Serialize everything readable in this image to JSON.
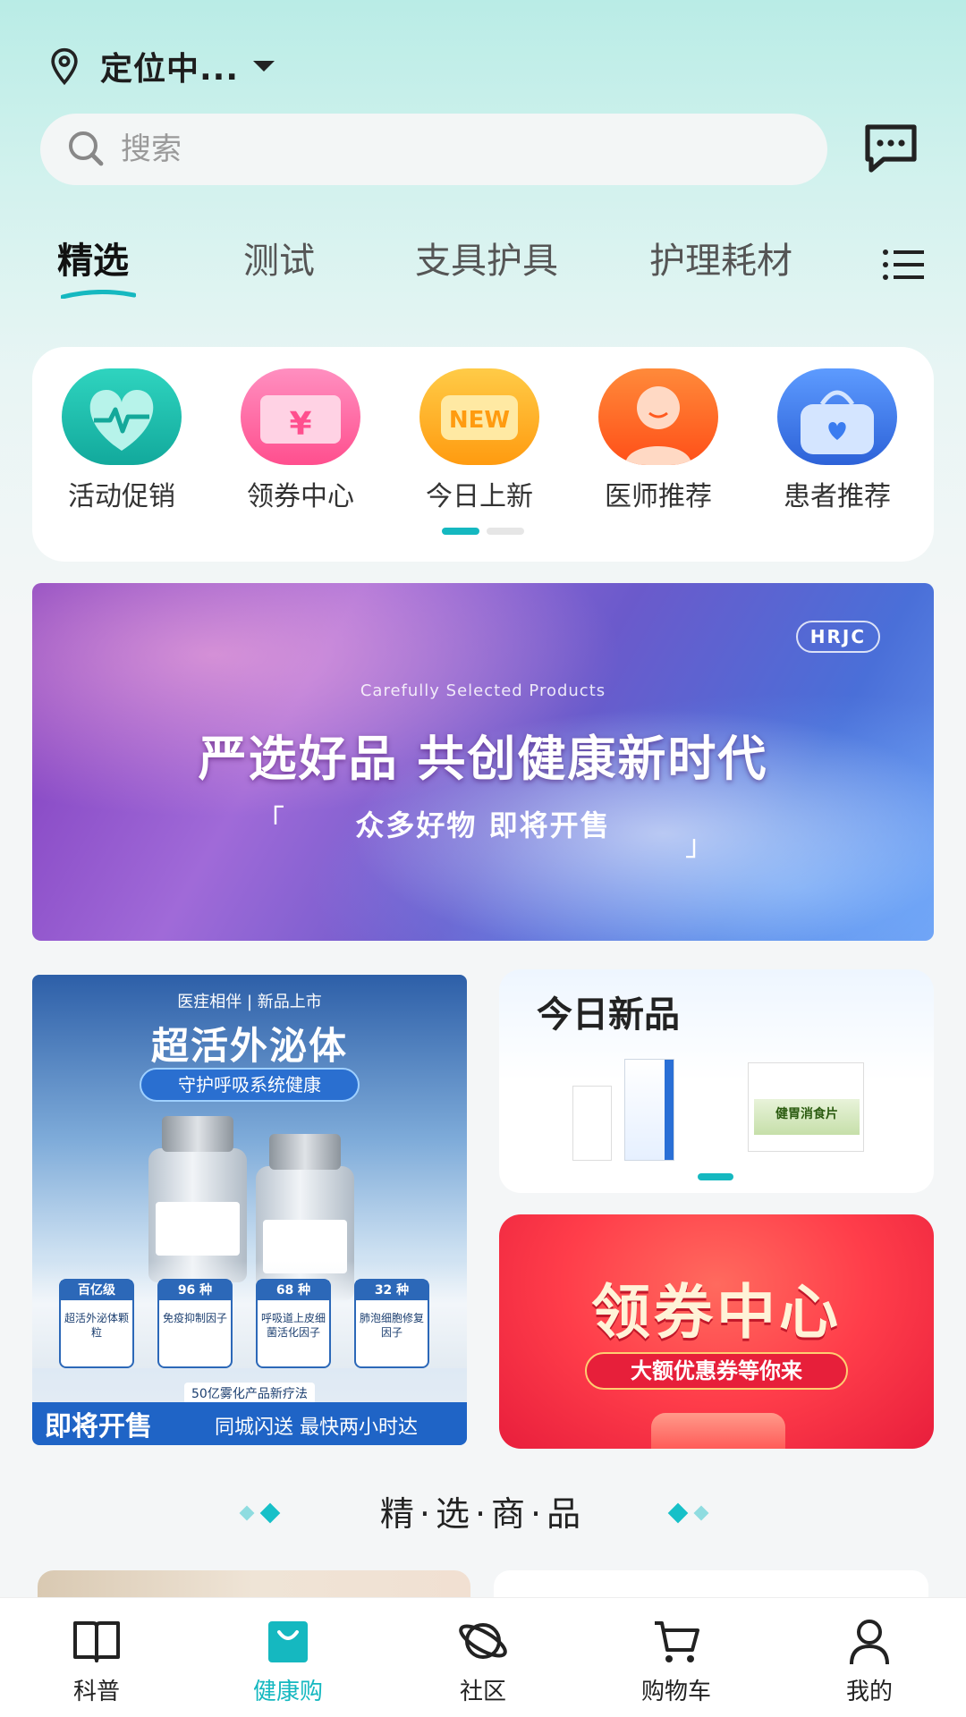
{
  "header": {
    "location_text": "定位中...",
    "search_placeholder": "搜索"
  },
  "tabs": [
    {
      "label": "精选",
      "active": true
    },
    {
      "label": "测试",
      "active": false
    },
    {
      "label": "支具护具",
      "active": false
    },
    {
      "label": "护理耗材",
      "active": false
    }
  ],
  "categories": [
    {
      "label": "活动促销",
      "icon": "heart-pulse-icon",
      "color": "#1fc4b0"
    },
    {
      "label": "领券中心",
      "icon": "coupon-icon",
      "color": "#ff6fa5"
    },
    {
      "label": "今日上新",
      "icon": "new-badge-icon",
      "color": "#ffb11f"
    },
    {
      "label": "医师推荐",
      "icon": "doctor-icon",
      "color": "#ff6a2a"
    },
    {
      "label": "患者推荐",
      "icon": "patient-bag-icon",
      "color": "#3a7cf0"
    }
  ],
  "banner": {
    "brand": "HRJC",
    "subtitle_en": "Carefully Selected Products",
    "title": "严选好品 共创健康新时代",
    "tagline": "众多好物 即将开售"
  },
  "promo_left": {
    "top_line": "医疰相伴 | 新品上市",
    "title": "超活外泌体",
    "pill": "守护呼吸系统健康",
    "cards": [
      {
        "head": "百亿级",
        "body": "超活外泌体颗粒"
      },
      {
        "head": "96 种",
        "body": "免疫抑制因子"
      },
      {
        "head": "68 种",
        "body": "呼吸道上皮细菌活化因子"
      },
      {
        "head": "32 种",
        "body": "肺泡细胞修复因子"
      }
    ],
    "note": "50亿雾化产品新疗法",
    "bar_left": "即将开售",
    "bar_right": "同城闪送 最快两小时达"
  },
  "promo_rt": {
    "title": "今日新品",
    "product_name": "健胃消食片"
  },
  "promo_rb": {
    "title": "领券中心",
    "pill": "大额优惠券等你来"
  },
  "section": {
    "title": "精·选·商·品"
  },
  "tabbar": [
    {
      "label": "科普",
      "icon": "book-icon",
      "active": false
    },
    {
      "label": "健康购",
      "icon": "shopping-bag-icon",
      "active": true
    },
    {
      "label": "社区",
      "icon": "planet-icon",
      "active": false
    },
    {
      "label": "购物车",
      "icon": "cart-icon",
      "active": false
    },
    {
      "label": "我的",
      "icon": "user-icon",
      "active": false
    }
  ],
  "colors": {
    "accent": "#15b8c0",
    "header_bg": "#b9ece6"
  }
}
